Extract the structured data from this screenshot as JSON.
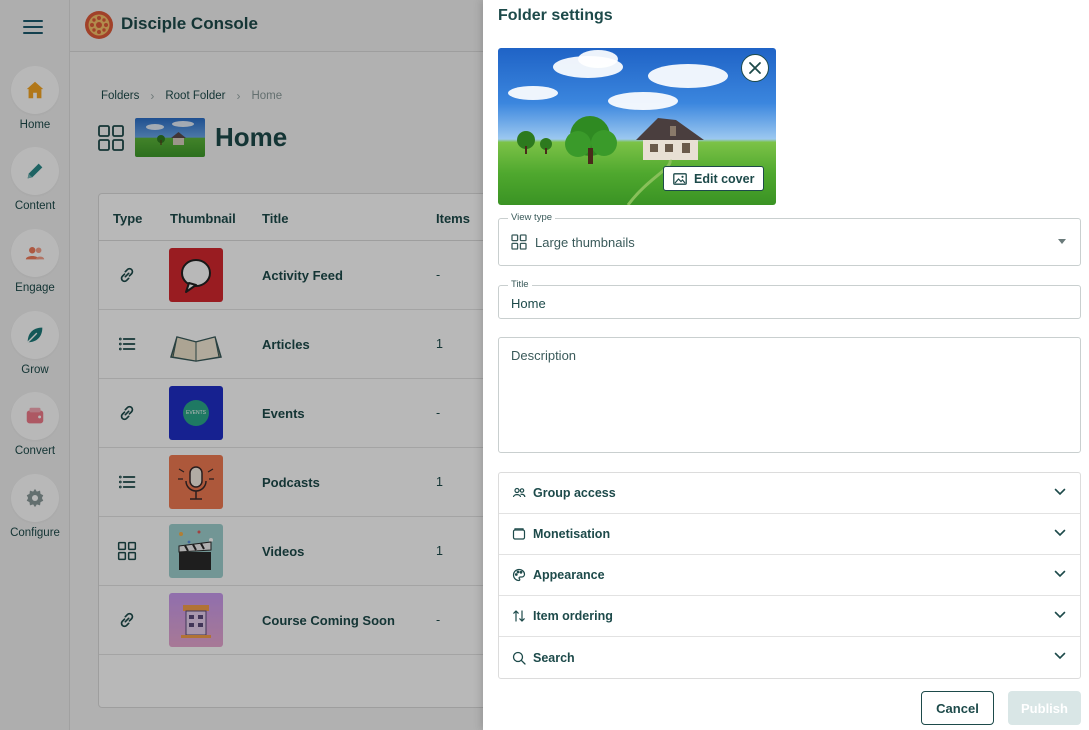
{
  "sidebar": {
    "menu_icon": "hamburger-icon",
    "items": [
      {
        "label": "Home",
        "icon": "home-icon",
        "color": "#f5a623"
      },
      {
        "label": "Content",
        "icon": "pencil-icon",
        "color": "#2a8a8a"
      },
      {
        "label": "Engage",
        "icon": "people-icon",
        "color": "#f07a5a"
      },
      {
        "label": "Grow",
        "icon": "leaf-icon",
        "color": "#1d7a7a"
      },
      {
        "label": "Convert",
        "icon": "wallet-icon",
        "color": "#f07a8a"
      },
      {
        "label": "Configure",
        "icon": "gear-icon",
        "color": "#8a9a9a"
      }
    ]
  },
  "header": {
    "title": "Disciple Console",
    "logo_icon": "disciple-logo"
  },
  "breadcrumb": [
    "Folders",
    "Root Folder",
    "Home"
  ],
  "page": {
    "title": "Home"
  },
  "table": {
    "columns": {
      "type": "Type",
      "thumbnail": "Thumbnail",
      "title": "Title",
      "items": "Items"
    },
    "rows": [
      {
        "type_icon": "link-icon",
        "title": "Activity Feed",
        "items": "-"
      },
      {
        "type_icon": "list-icon",
        "title": "Articles",
        "items": "1"
      },
      {
        "type_icon": "link-icon",
        "title": "Events",
        "items": "-",
        "thumb_text": "EVENTS"
      },
      {
        "type_icon": "list-icon",
        "title": "Podcasts",
        "items": "1"
      },
      {
        "type_icon": "grid-icon",
        "title": "Videos",
        "items": "1"
      },
      {
        "type_icon": "link-icon",
        "title": "Course Coming Soon",
        "items": "-"
      }
    ]
  },
  "panel": {
    "title": "Folder settings",
    "edit_cover_label": "Edit cover",
    "view_type": {
      "legend": "View type",
      "value": "Large thumbnails"
    },
    "title_field": {
      "legend": "Title",
      "value": "Home"
    },
    "description_placeholder": "Description",
    "sections": [
      {
        "label": "Group access",
        "icon": "group-icon"
      },
      {
        "label": "Monetisation",
        "icon": "wallet-outline-icon"
      },
      {
        "label": "Appearance",
        "icon": "palette-icon"
      },
      {
        "label": "Item ordering",
        "icon": "sort-arrows-icon"
      },
      {
        "label": "Search",
        "icon": "search-icon"
      }
    ],
    "cancel_label": "Cancel",
    "publish_label": "Publish"
  },
  "colors": {
    "brand_dark": "#1d4a4a",
    "publish_disabled": "#d9e6e6"
  }
}
